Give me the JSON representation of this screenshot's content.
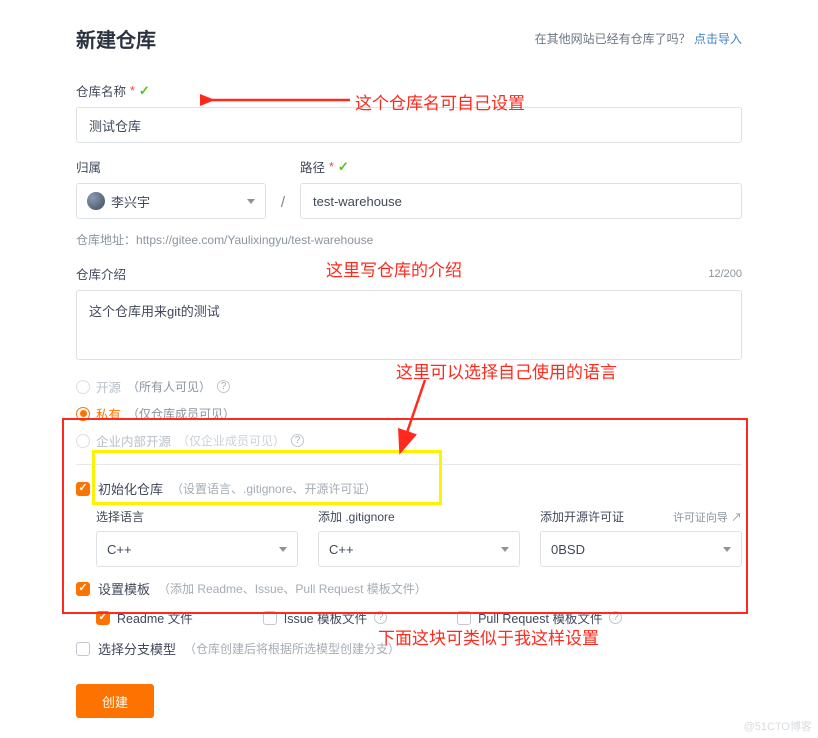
{
  "header": {
    "title": "新建仓库",
    "existing_prompt": "在其他网站已经有仓库了吗？",
    "import_link": "点击导入"
  },
  "form": {
    "name_label": "仓库名称",
    "name_value": "测试仓库",
    "owner_label": "归属",
    "owner_value": "李兴宇",
    "slash": "/",
    "path_label": "路径",
    "path_value": "test-warehouse",
    "url_label": "仓库地址：",
    "url_value": "https://gitee.com/Yaulixingyu/test-warehouse",
    "intro_label": "仓库介绍",
    "intro_counter": "12/200",
    "intro_value": "这个仓库用来git的测试"
  },
  "visibility": {
    "public_label": "开源",
    "public_desc": "（所有人可见）",
    "private_label": "私有",
    "private_desc": "（仅仓库成员可见）",
    "enterprise_label": "企业内部开源",
    "enterprise_desc": "（仅企业成员可见）"
  },
  "init": {
    "label": "初始化仓库",
    "desc": "（设置语言、.gitignore、开源许可证）",
    "lang_label": "选择语言",
    "lang_value": "C++",
    "gitignore_label": "添加 .gitignore",
    "gitignore_value": "C++",
    "license_label": "添加开源许可证",
    "license_guide": "许可证向导 ↗",
    "license_value": "0BSD"
  },
  "template": {
    "label": "设置模板",
    "desc": "（添加 Readme、Issue、Pull Request 模板文件）",
    "readme": "Readme 文件",
    "issue": "Issue 模板文件",
    "pr": "Pull Request 模板文件"
  },
  "branch": {
    "label": "选择分支模型",
    "desc": "（仓库创建后将根据所选模型创建分支）"
  },
  "buttons": {
    "create": "创建"
  },
  "annotations": {
    "a1": "这个仓库名可自己设置",
    "a2": "这里写仓库的介绍",
    "a3": "这里可以选择自己使用的语言",
    "a4": "下面这块可类似于我这样设置"
  },
  "watermark": "@51CTO博客"
}
